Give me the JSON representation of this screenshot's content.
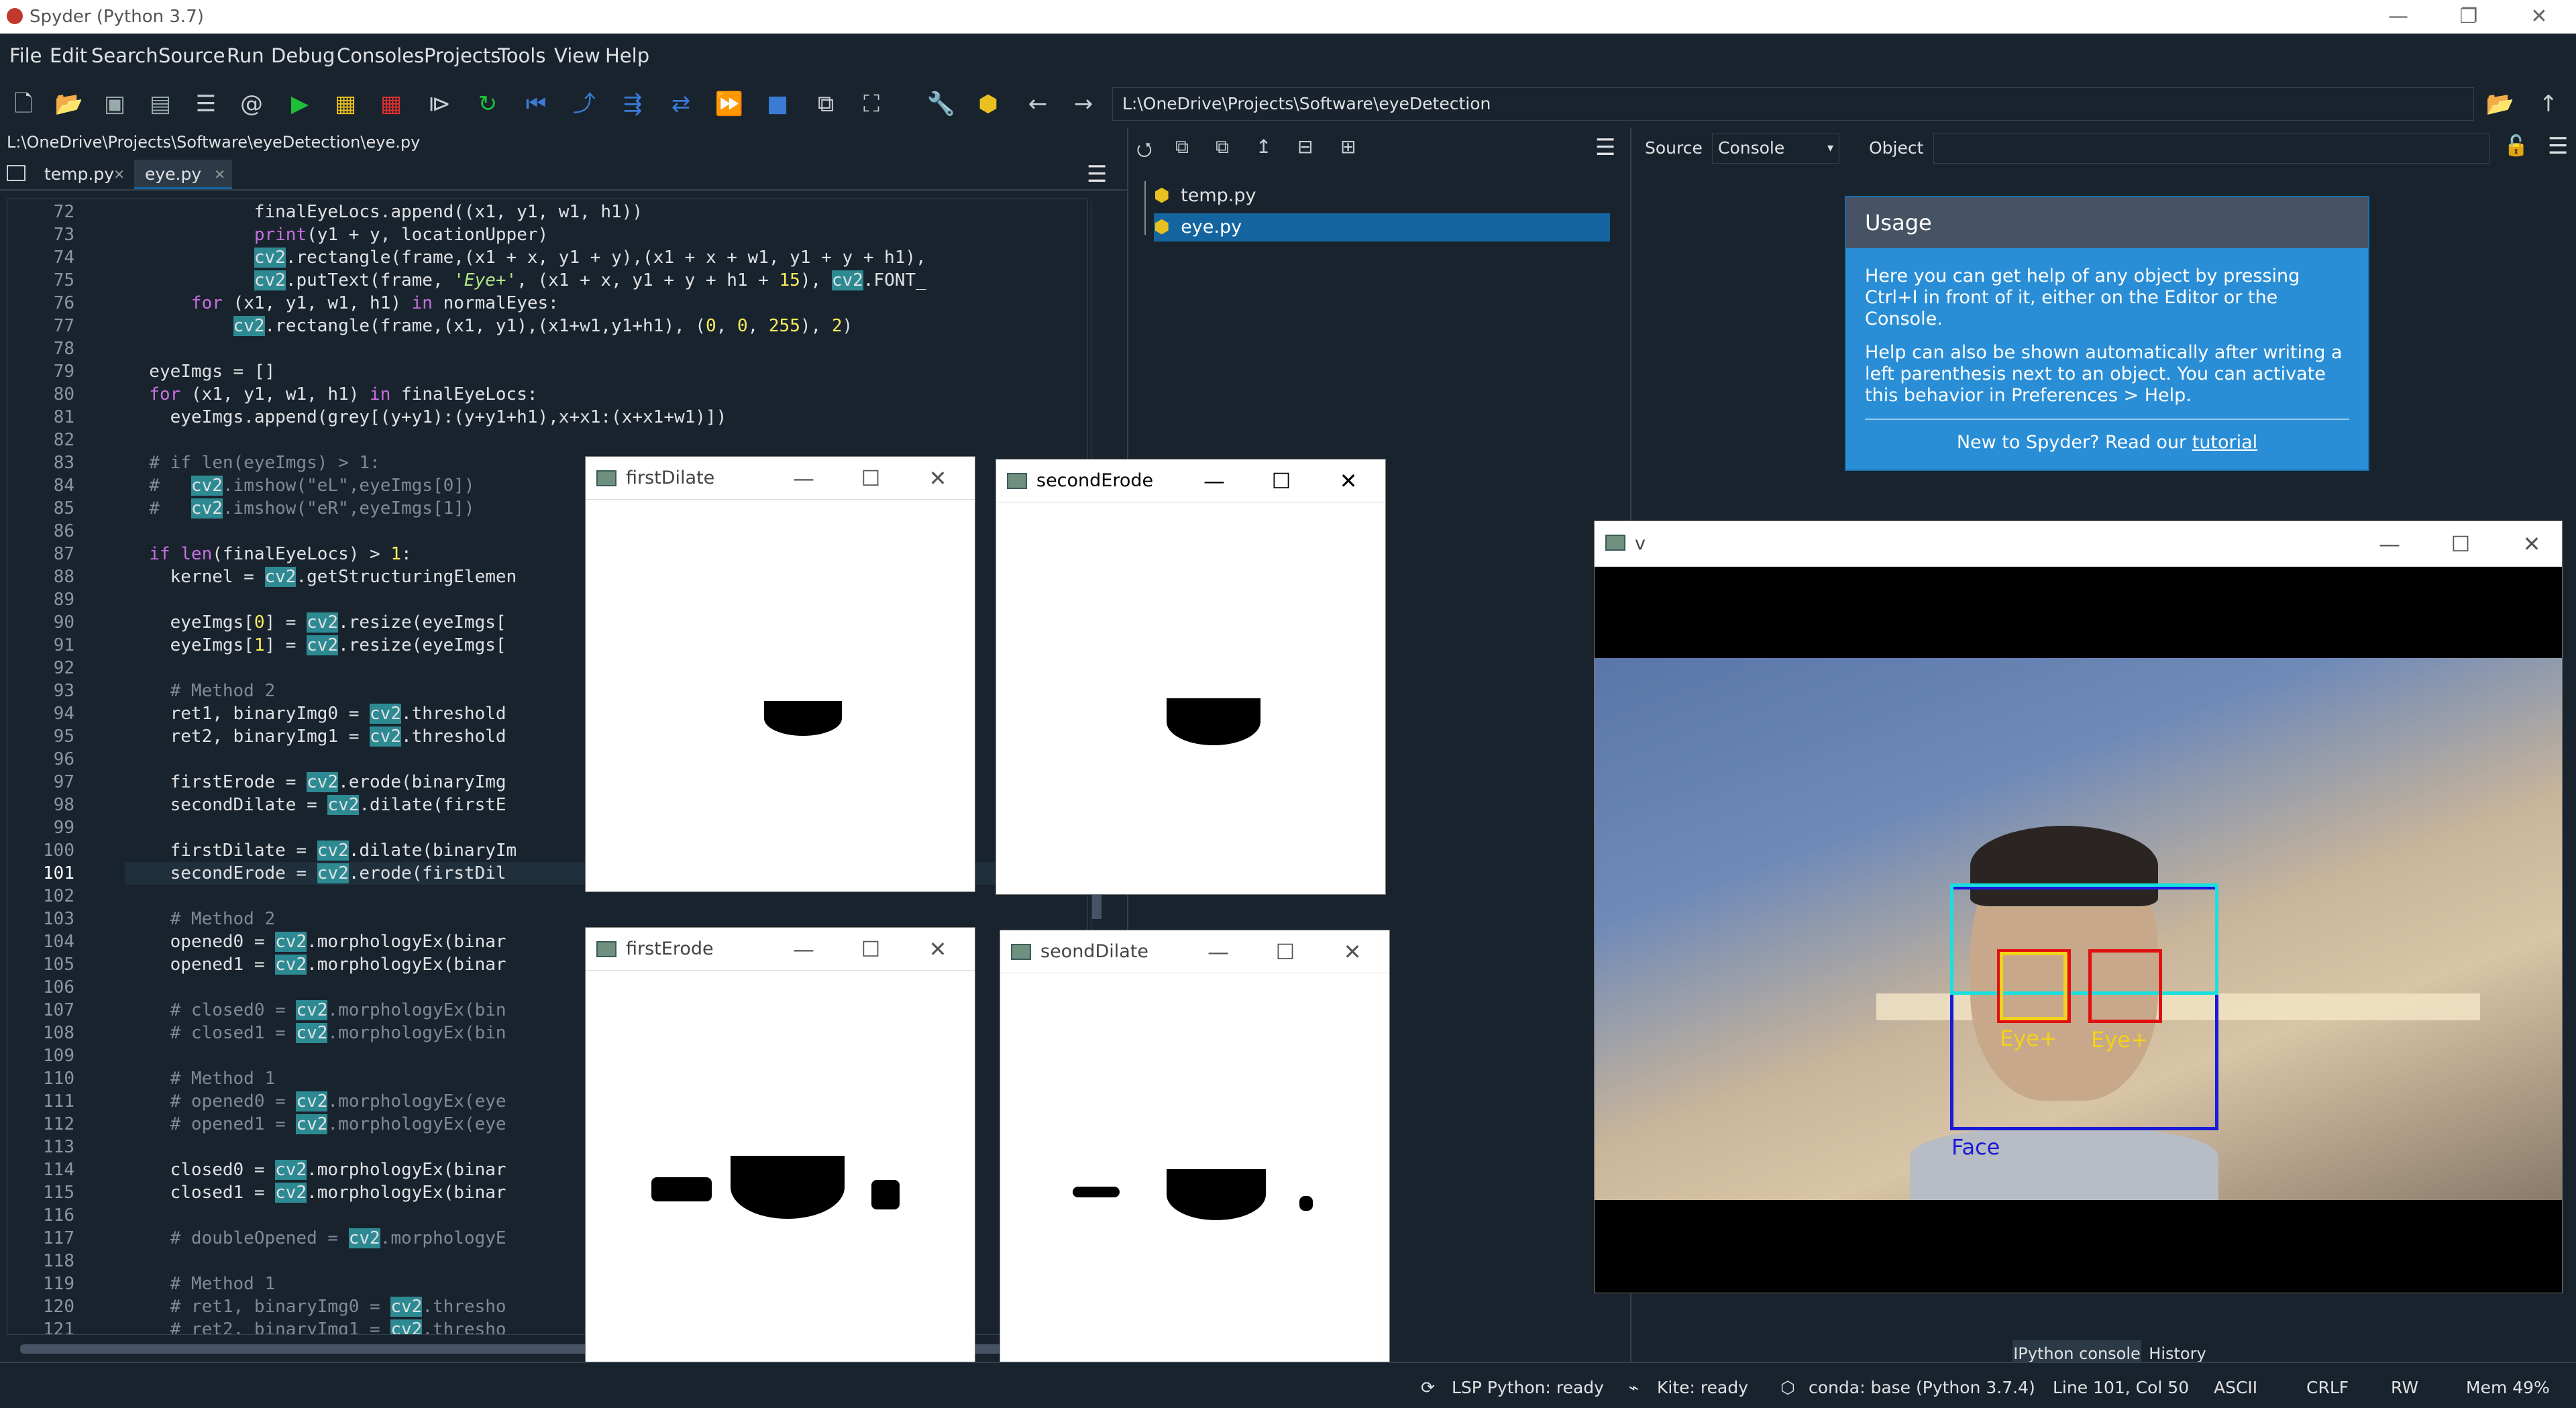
{
  "window": {
    "title": "Spyder (Python 3.7)",
    "min": "—",
    "max": "❐",
    "close": "✕"
  },
  "menu": [
    "File",
    "Edit",
    "Search",
    "Source",
    "Run",
    "Debug",
    "Consoles",
    "Projects",
    "Tools",
    "View",
    "Help"
  ],
  "toolbar": {
    "path": "L:\\OneDrive\\Projects\\Software\\eyeDetection"
  },
  "editor": {
    "filepath": "L:\\OneDrive\\Projects\\Software\\eyeDetection\\eye.py",
    "tabs": [
      {
        "label": "temp.py"
      },
      {
        "label": "eye.py"
      }
    ],
    "close_glyph": "✕",
    "lines": [
      {
        "n": "72",
        "t": "            finalEyeLocs.append((x1, y1, w1, h1))"
      },
      {
        "n": "73",
        "t": "            print(y1 + y, locationUpper)"
      },
      {
        "n": "74",
        "t": "            cv2.rectangle(frame,(x1 + x, y1 + y),(x1 + x + w1, y1 + y + h1),"
      },
      {
        "n": "75",
        "t": "            cv2.putText(frame, 'Eye+', (x1 + x, y1 + y + h1 + 15), cv2.FONT_"
      },
      {
        "n": "76",
        "t": "      for (x1, y1, w1, h1) in normalEyes:"
      },
      {
        "n": "77",
        "t": "          cv2.rectangle(frame,(x1, y1),(x1+w1,y1+h1), (0, 0, 255), 2)"
      },
      {
        "n": "78",
        "t": ""
      },
      {
        "n": "79",
        "t": "  eyeImgs = []"
      },
      {
        "n": "80",
        "t": "  for (x1, y1, w1, h1) in finalEyeLocs:"
      },
      {
        "n": "81",
        "t": "    eyeImgs.append(grey[(y+y1):(y+y1+h1),x+x1:(x+x1+w1)])"
      },
      {
        "n": "82",
        "t": ""
      },
      {
        "n": "83",
        "t": "  # if len(eyeImgs) > 1:"
      },
      {
        "n": "84",
        "t": "  #   cv2.imshow(\"eL\",eyeImgs[0])"
      },
      {
        "n": "85",
        "t": "  #   cv2.imshow(\"eR\",eyeImgs[1])"
      },
      {
        "n": "86",
        "t": ""
      },
      {
        "n": "87",
        "t": "  if len(finalEyeLocs) > 1:"
      },
      {
        "n": "88",
        "t": "    kernel = cv2.getStructuringElemen"
      },
      {
        "n": "89",
        "t": ""
      },
      {
        "n": "90",
        "t": "    eyeImgs[0] = cv2.resize(eyeImgs["
      },
      {
        "n": "91",
        "t": "    eyeImgs[1] = cv2.resize(eyeImgs["
      },
      {
        "n": "92",
        "t": ""
      },
      {
        "n": "93",
        "t": "    # Method 2"
      },
      {
        "n": "94",
        "t": "    ret1, binaryImg0 = cv2.threshold"
      },
      {
        "n": "95",
        "t": "    ret2, binaryImg1 = cv2.threshold"
      },
      {
        "n": "96",
        "t": ""
      },
      {
        "n": "97",
        "t": "    firstErode = cv2.erode(binaryImg"
      },
      {
        "n": "98",
        "t": "    secondDilate = cv2.dilate(firstE"
      },
      {
        "n": "99",
        "t": ""
      },
      {
        "n": "100",
        "t": "    firstDilate = cv2.dilate(binaryIm"
      },
      {
        "n": "101",
        "t": "    secondErode = cv2.erode(firstDil"
      },
      {
        "n": "102",
        "t": ""
      },
      {
        "n": "103",
        "t": "    # Method 2"
      },
      {
        "n": "104",
        "t": "    opened0 = cv2.morphologyEx(binar"
      },
      {
        "n": "105",
        "t": "    opened1 = cv2.morphologyEx(binar"
      },
      {
        "n": "106",
        "t": ""
      },
      {
        "n": "107",
        "t": "    # closed0 = cv2.morphologyEx(bin"
      },
      {
        "n": "108",
        "t": "    # closed1 = cv2.morphologyEx(bin"
      },
      {
        "n": "109",
        "t": ""
      },
      {
        "n": "110",
        "t": "    # Method 1"
      },
      {
        "n": "111",
        "t": "    # opened0 = cv2.morphologyEx(eye"
      },
      {
        "n": "112",
        "t": "    # opened1 = cv2.morphologyEx(eye"
      },
      {
        "n": "113",
        "t": ""
      },
      {
        "n": "114",
        "t": "    closed0 = cv2.morphologyEx(binar"
      },
      {
        "n": "115",
        "t": "    closed1 = cv2.morphologyEx(binar"
      },
      {
        "n": "116",
        "t": ""
      },
      {
        "n": "117",
        "t": "    # doubleOpened = cv2.morphologyE"
      },
      {
        "n": "118",
        "t": ""
      },
      {
        "n": "119",
        "t": "    # Method 1"
      },
      {
        "n": "120",
        "t": "    # ret1, binaryImg0 = cv2.thresho"
      },
      {
        "n": "121",
        "t": "    # ret2, binaryImg1 = cv2.thresho"
      }
    ],
    "current_line": "101"
  },
  "files": {
    "items": [
      "temp.py",
      "eye.py"
    ],
    "selected": "eye.py"
  },
  "help": {
    "source_label": "Source",
    "source_value": "Console",
    "object_label": "Object",
    "usage_title": "Usage",
    "p1": "Here you can get help of any object by pressing Ctrl+I in front of it, either on the Editor or the Console.",
    "p2": "Help can also be shown automatically after writing a left parenthesis next to an object. You can activate this behavior in Preferences > Help.",
    "new_prefix": "New to Spyder? Read our ",
    "new_link": "tutorial"
  },
  "cvwindows": {
    "firstDilate": "firstDilate",
    "secondErode": "secondErode",
    "firstErode": "firstErode",
    "secondDilate": "seondDilate",
    "video": "v"
  },
  "video": {
    "face_label": "Face",
    "eye_label_1": "Eye+",
    "eye_label_2": "Eye+"
  },
  "console_tabs": [
    "IPython console",
    "History"
  ],
  "status": {
    "lsp": "LSP Python: ready",
    "kite": "Kite: ready",
    "conda": "conda: base (Python 3.7.4)",
    "pos": "Line 101, Col 50",
    "enc": "ASCII",
    "eol": "CRLF",
    "rw": "RW",
    "mem": "Mem 49%"
  },
  "colors": {
    "bg": "#19232d",
    "cv2_highlight": "#2d8a93",
    "usage_blue": "#2a8ed6",
    "face_box": "#1a1ad8",
    "eye_box": "#e01010",
    "eye_inner": "#f2d21a",
    "cyan_box": "#19e0e0"
  }
}
